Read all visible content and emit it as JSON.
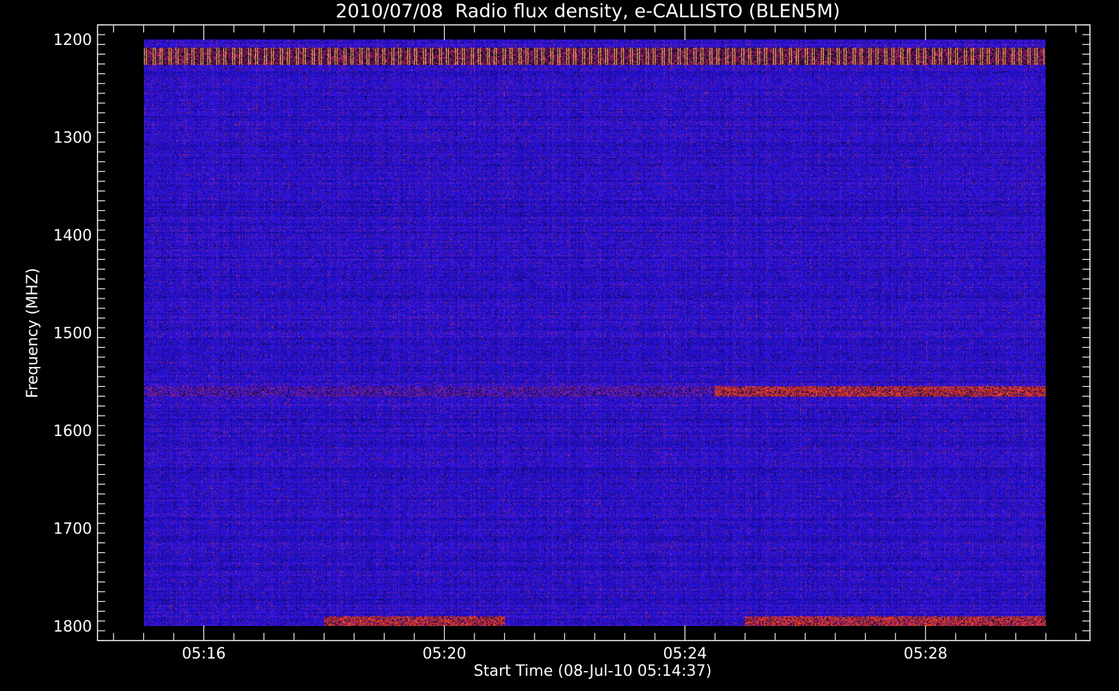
{
  "chart_data": {
    "type": "heatmap",
    "title": "2010/07/08  Radio flux density, e-CALLISTO (BLEN5M)",
    "xlabel": "Start Time (08-Jul-10 05:14:37)",
    "ylabel": "Frequency (MHZ)",
    "x_axis": {
      "unit": "time (UT)",
      "start": "05:14:37",
      "data_range": [
        "05:15:00",
        "05:30:00"
      ],
      "axis_range": [
        "05:14:14",
        "05:30:44"
      ],
      "ticks": [
        "05:16",
        "05:20",
        "05:24",
        "05:28"
      ],
      "minor_tick_interval_s": 30
    },
    "y_axis": {
      "unit": "MHz",
      "inverted": true,
      "range": [
        1185,
        1815
      ],
      "data_range": [
        1200,
        1800
      ],
      "ticks": [
        1200,
        1300,
        1400,
        1500,
        1600,
        1700,
        1800
      ],
      "minor_tick_interval": 10
    },
    "colormap": {
      "low": "#000000",
      "mid": "#2a14ff",
      "high": "#ff3300",
      "peak": "#ffff66"
    },
    "features": [
      {
        "kind": "rfi_band",
        "freq_mhz": [
          1208,
          1225
        ],
        "time": [
          "05:15:00",
          "05:30:00"
        ],
        "intensity": "peak",
        "pattern": "dashed"
      },
      {
        "kind": "emission_band",
        "freq_mhz": [
          1555,
          1565
        ],
        "time": [
          "05:15:00",
          "05:24:30"
        ],
        "intensity": "medium"
      },
      {
        "kind": "emission_band",
        "freq_mhz": [
          1555,
          1565
        ],
        "time": [
          "05:24:30",
          "05:30:00"
        ],
        "intensity": "high"
      },
      {
        "kind": "emission_band",
        "freq_mhz": [
          1790,
          1800
        ],
        "time": [
          "05:18:00",
          "05:21:00"
        ],
        "intensity": "high"
      },
      {
        "kind": "emission_band",
        "freq_mhz": [
          1790,
          1800
        ],
        "time": [
          "05:25:00",
          "05:30:00"
        ],
        "intensity": "high"
      }
    ]
  }
}
